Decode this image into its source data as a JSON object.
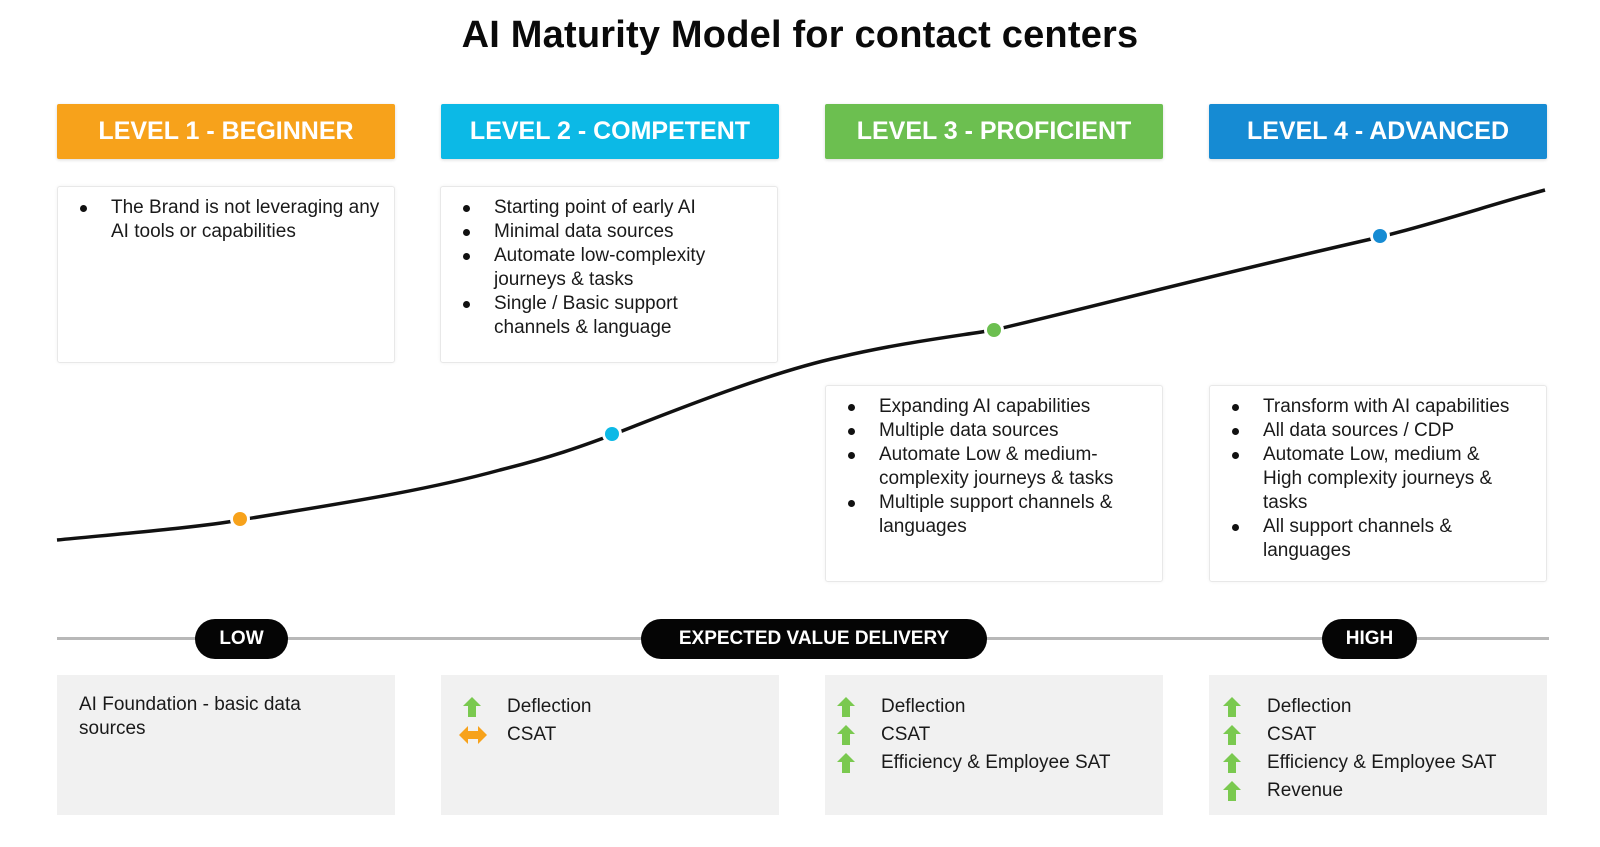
{
  "title": "AI Maturity Model for contact centers",
  "colors": {
    "level1": "#F7A21B",
    "level2": "#0CB9E6",
    "level3": "#6CBF50",
    "level4": "#168BD3",
    "arrow_up": "#7AC94F",
    "arrow_neutral": "#F7A21B"
  },
  "levels": [
    {
      "header": "LEVEL 1 - BEGINNER",
      "bullets": [
        "The Brand is not leveraging any AI tools or capabilities"
      ],
      "value_text": "AI Foundation - basic data sources",
      "metrics": []
    },
    {
      "header": "LEVEL 2 - COMPETENT",
      "bullets": [
        "Starting point of early AI",
        "Minimal data sources",
        "Automate low-complexity journeys & tasks",
        "Single / Basic support channels & language"
      ],
      "value_text": "",
      "metrics": [
        {
          "label": "Deflection",
          "trend": "up"
        },
        {
          "label": "CSAT",
          "trend": "neutral"
        }
      ]
    },
    {
      "header": "LEVEL 3 - PROFICIENT",
      "bullets": [
        "Expanding AI capabilities",
        "Multiple data sources",
        "Automate Low & medium-complexity journeys & tasks",
        "Multiple support channels & languages"
      ],
      "value_text": "",
      "metrics": [
        {
          "label": "Deflection",
          "trend": "up"
        },
        {
          "label": "CSAT",
          "trend": "up"
        },
        {
          "label": "Efficiency & Employee SAT",
          "trend": "up"
        }
      ]
    },
    {
      "header": "LEVEL 4 - ADVANCED",
      "bullets": [
        "Transform with AI capabilities",
        "All data sources / CDP",
        "Automate Low, medium & High complexity journeys & tasks",
        "All support channels & languages"
      ],
      "value_text": "",
      "metrics": [
        {
          "label": "Deflection",
          "trend": "up"
        },
        {
          "label": "CSAT",
          "trend": "up"
        },
        {
          "label": "Efficiency & Employee SAT",
          "trend": "up"
        },
        {
          "label": "Revenue",
          "trend": "up"
        }
      ]
    }
  ],
  "value_axis": {
    "low_label": "LOW",
    "center_label": "EXPECTED VALUE DELIVERY",
    "high_label": "HIGH"
  },
  "icons": {
    "trend_up": "arrow-up-icon",
    "trend_neutral": "double-arrow-horizontal-icon",
    "bullet": "bullet-dot-icon",
    "milestone": "milestone-dot-icon"
  }
}
